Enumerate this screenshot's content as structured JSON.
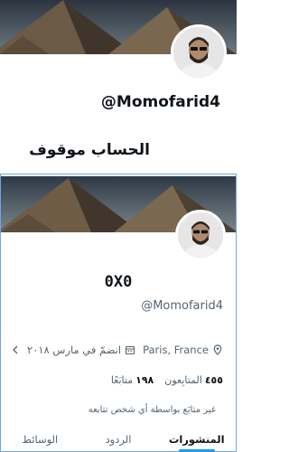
{
  "top_card": {
    "handle": "@Momofarid4",
    "status": "الحساب موقوف"
  },
  "profile": {
    "display_name": "0X0",
    "handle": "@Momofarid4",
    "location": "Paris, France",
    "joined": "انضمّ في مارس ٢٠١٨",
    "followers_count": "٤٥٥",
    "followers_label": "المتابِعون",
    "following_count": "١٩٨",
    "following_label": "متابَعًا",
    "not_followed_text": "غير متابَع بواسطة أي شخص تتابعه"
  },
  "tabs": [
    {
      "label": "المنشورات",
      "active": true
    },
    {
      "label": "الردود",
      "active": false
    },
    {
      "label": "الوسائط",
      "active": false
    }
  ],
  "colors": {
    "accent": "#1d9bf0",
    "muted_text": "#536471",
    "selection_border": "#6aa7e8"
  },
  "icons": {
    "location": "location-pin-icon",
    "calendar": "calendar-icon",
    "chevron": "chevron-left-icon"
  }
}
